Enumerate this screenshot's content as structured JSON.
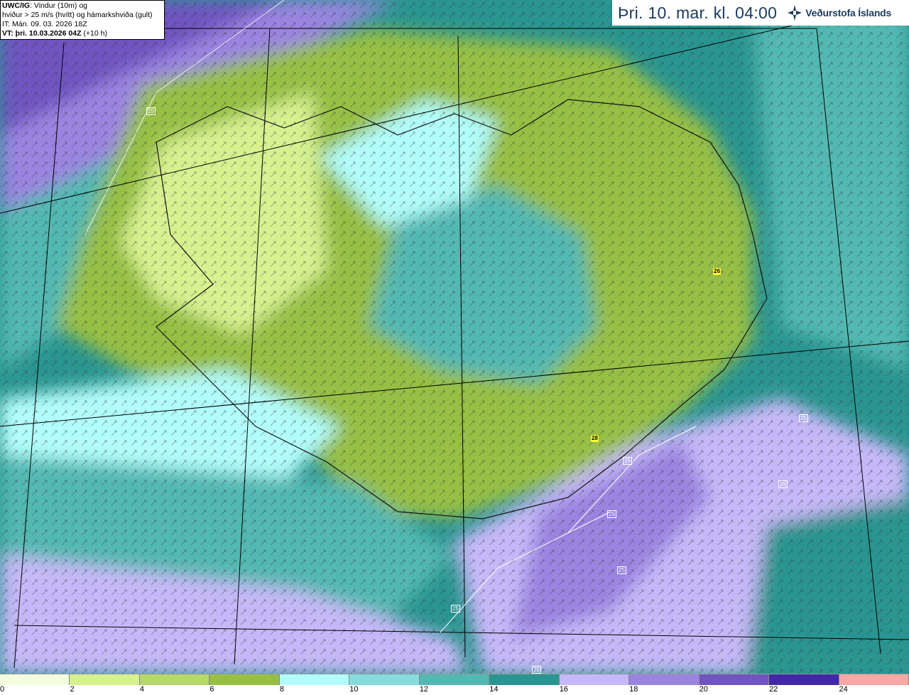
{
  "info": {
    "model": "UWC/IG",
    "description_1": ": Vindur (10m) og",
    "description_2": "hviður > 25 m/s (hvítt) og hámarkshviða (gult)",
    "initial_time": "IT: Mán. 09. 03. 2026 18Z",
    "valid_label": "VT: þri. 10.03.2026 04Z",
    "valid_offset": "(+10 h)"
  },
  "header": {
    "date": "Þri. 10. mar. kl. 04:00",
    "brand": "Veðurstofa Íslands",
    "logo_icon": "vedurstofa-logo-icon",
    "brand_color": "#1b3a5c"
  },
  "legend": {
    "unit_ticks": [
      "0",
      "2",
      "4",
      "6",
      "8",
      "10",
      "12",
      "14",
      "16",
      "18",
      "20",
      "22",
      "24"
    ],
    "colors": [
      "#f4fde0",
      "#d7f191",
      "#b4d86b",
      "#97bf45",
      "#b2fdfb",
      "#86dcdc",
      "#53b8b2",
      "#2a9590",
      "#c6b8f8",
      "#9a84e0",
      "#7054c0",
      "#4228a6",
      "#f8a8a4"
    ]
  },
  "map_labels": {
    "gust_contours": [
      "25",
      "25",
      "25",
      "25",
      "25",
      "25",
      "25",
      "25"
    ],
    "max_gusts": [
      "26",
      "28"
    ]
  }
}
